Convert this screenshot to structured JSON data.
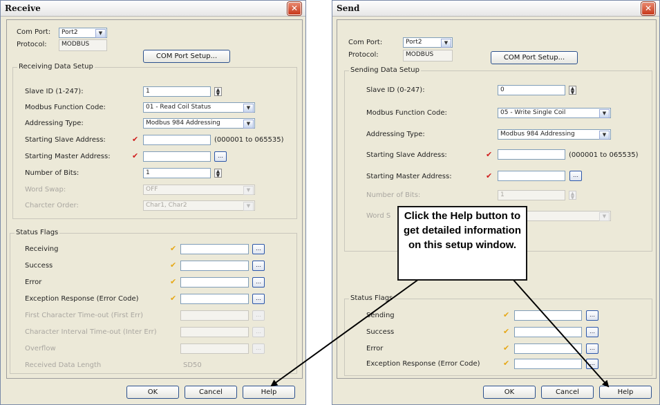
{
  "receive": {
    "title": "Receive",
    "close": "✕",
    "com_port_label": "Com Port:",
    "com_port_value": "Port2",
    "protocol_label": "Protocol:",
    "protocol_value": "MODBUS",
    "com_setup_button": "COM Port Setup...",
    "group_title": "Receiving Data Setup",
    "slave_id_label": "Slave ID (1-247):",
    "slave_id_value": "1",
    "func_label": "Modbus Function Code:",
    "func_value": "01 - Read Coil Status",
    "addr_type_label": "Addressing Type:",
    "addr_type_value": "Modbus 984 Addressing",
    "start_slave_label": "Starting Slave Address:",
    "start_slave_value": "",
    "start_slave_range": "(000001 to 065535)",
    "start_master_label": "Starting Master Address:",
    "num_bits_label": "Number of Bits:",
    "num_bits_value": "1",
    "word_swap_label": "Word Swap:",
    "word_swap_value": "OFF",
    "char_order_label": "Charcter Order:",
    "char_order_value": "Char1, Char2",
    "status_title": "Status Flags",
    "flags": [
      "Receiving",
      "Success",
      "Error",
      "Exception Response (Error Code)"
    ],
    "disabled_flags": [
      "First Character Time-out (First Err)",
      "Character Interval Time-out (Inter Err)",
      "Overflow"
    ],
    "recv_len_label": "Received Data Length",
    "recv_len_value": "SD50",
    "ok": "OK",
    "cancel": "Cancel",
    "help": "Help"
  },
  "send": {
    "title": "Send",
    "close": "✕",
    "com_port_label": "Com Port:",
    "com_port_value": "Port2",
    "protocol_label": "Protocol:",
    "protocol_value": "MODBUS",
    "com_setup_button": "COM Port Setup...",
    "group_title": "Sending Data Setup",
    "slave_id_label": "Slave ID (0-247):",
    "slave_id_value": "0",
    "func_label": "Modbus Function Code:",
    "func_value": "05 - Write Single Coil",
    "addr_type_label": "Addressing Type:",
    "addr_type_value": "Modbus 984 Addressing",
    "start_slave_label": "Starting Slave Address:",
    "start_slave_range": "(000001 to 065535)",
    "start_master_label": "Starting Master Address:",
    "num_bits_label": "Number of Bits:",
    "num_bits_value": "1",
    "word_swap_label": "Word S",
    "status_title": "Status Flags",
    "flags": [
      "Sending",
      "Success",
      "Error",
      "Exception Response (Error Code)"
    ],
    "ok": "OK",
    "cancel": "Cancel",
    "help": "Help"
  },
  "callout": {
    "text": "Click the Help button to get detailed information on this setup window."
  },
  "icons": {
    "red_check": "check-mark-red",
    "gold_check": "check-mark-gold",
    "dropdown": "chevron-down",
    "browse": "ellipsis"
  },
  "colors": {
    "dialog_bg": "#ece9d8",
    "close_button": "#c8391c",
    "required_check": "#d01c1c",
    "flag_check": "#e6a817"
  }
}
